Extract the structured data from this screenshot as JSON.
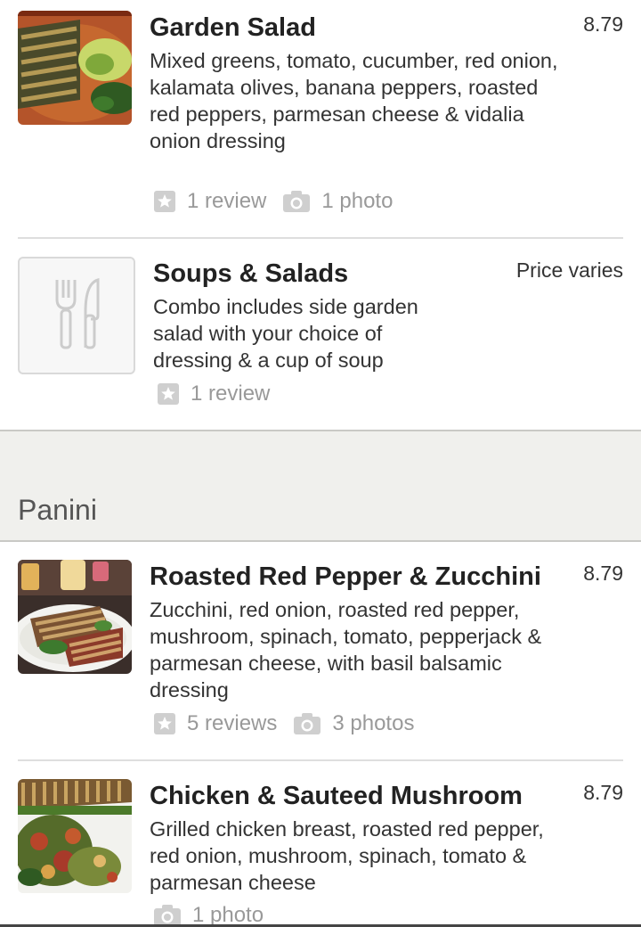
{
  "items": [
    {
      "title": "Garden Salad",
      "price": "8.79",
      "description": "Mixed greens, tomato, cucumber, red onion, kalamata olives, banana peppers, roasted red peppers, parmesan cheese & vidalia onion dressing",
      "reviews": "1 review",
      "photos": "1 photo"
    },
    {
      "title": "Soups & Salads",
      "price": "Price varies",
      "description": "Combo includes side garden salad with your choice of dressing & a cup of soup",
      "reviews": "1 review"
    }
  ],
  "section": {
    "title": "Panini"
  },
  "panini": [
    {
      "title": "Roasted Red Pepper & Zucchini",
      "price": "8.79",
      "description": "Zucchini, red onion, roasted red pepper, mushroom, spinach, tomato, pepperjack & parmesan cheese, with basil balsamic dressing",
      "reviews": "5 reviews",
      "photos": "3 photos"
    },
    {
      "title": "Chicken & Sauteed Mushroom",
      "price": "8.79",
      "description": "Grilled chicken breast, roasted red pepper, red onion, mushroom, spinach, tomato & parmesan cheese",
      "photos": "1 photo"
    }
  ],
  "icons": {
    "review": "star-icon",
    "photo": "camera-icon",
    "placeholder": "fork-knife-icon"
  },
  "colors": {
    "text": "#333333",
    "meta": "#999999",
    "section_bg": "#f0f0ed"
  }
}
